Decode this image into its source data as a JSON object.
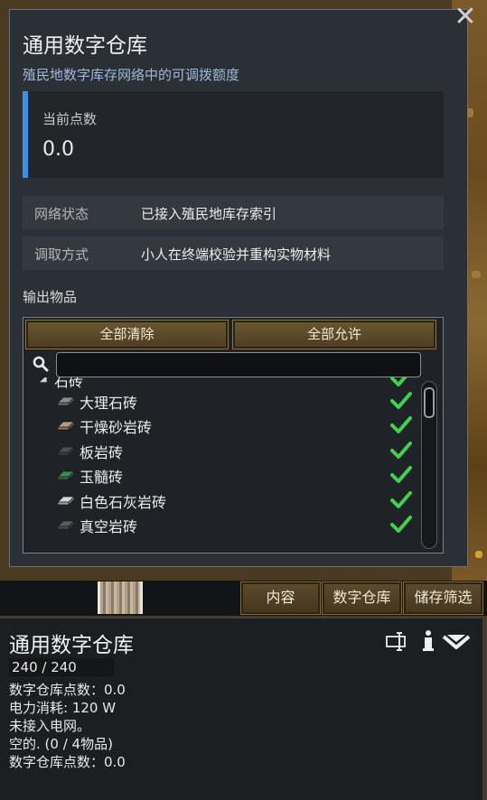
{
  "dialog": {
    "title": "通用数字仓库",
    "subtitle": "殖民地数字库存网络中的可调拨额度",
    "close_icon": "close-icon",
    "points": {
      "label": "当前点数",
      "value": "0.0"
    },
    "info_rows": [
      {
        "key": "网络状态",
        "value": "已接入殖民地库存索引"
      },
      {
        "key": "调取方式",
        "value": "小人在终端校验并重构实物材料"
      }
    ],
    "output_label": "输出物品",
    "filter": {
      "clear_all_label": "全部清除",
      "allow_all_label": "全部允许",
      "search_placeholder": "",
      "search_icon": "search-icon",
      "category": {
        "label": "石砖",
        "expanded": true,
        "allowed": true
      },
      "items": [
        {
          "label": "大理石砖",
          "color": "#8c8c8c",
          "allowed": true
        },
        {
          "label": "干燥砂岩砖",
          "color": "#b59a80",
          "allowed": true
        },
        {
          "label": "板岩砖",
          "color": "#4e4e4e",
          "allowed": true
        },
        {
          "label": "玉髓砖",
          "color": "#3f8a4f",
          "allowed": true
        },
        {
          "label": "白色石灰岩砖",
          "color": "#d6d6d2",
          "allowed": true
        },
        {
          "label": "真空岩砖",
          "color": "#5c5c5c",
          "allowed": true
        }
      ]
    }
  },
  "tabs": [
    {
      "label": "内容"
    },
    {
      "label": "数字仓库"
    },
    {
      "label": "储存筛选"
    }
  ],
  "inspect": {
    "title": "通用数字仓库",
    "hp_text": "240 / 240",
    "hp_fraction": 1.0,
    "lines": [
      "数字仓库点数：0.0",
      "电力消耗: 120 W",
      "未接入电网。",
      "空的. (0 / 4物品)",
      "数字仓库点数：0.0"
    ],
    "icons": [
      "rename-icon",
      "info-icon",
      "menu-dropdown-icon"
    ]
  },
  "colors": {
    "accent_blue": "#3a8fe6",
    "check_green": "#3fd24a",
    "panel_bg": "#2b3036"
  }
}
